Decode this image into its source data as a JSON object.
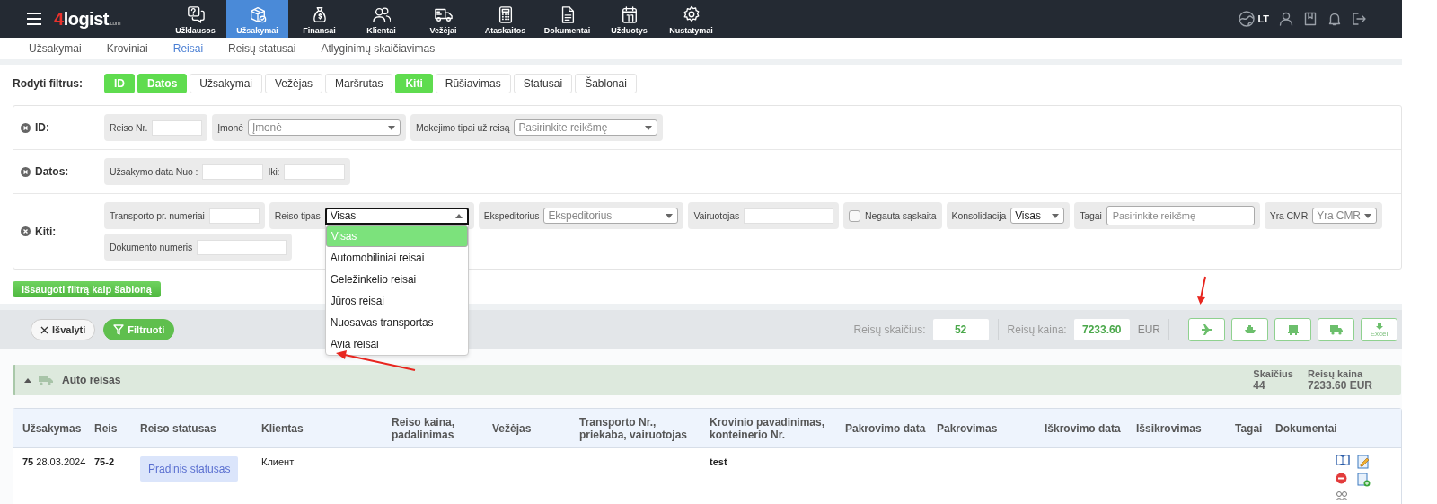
{
  "nav": {
    "logo": {
      "mark": "4",
      "name": "logist",
      "suffix": ".com"
    },
    "items": [
      {
        "label": "Užklausos",
        "selected": false
      },
      {
        "label": "Užsakymai",
        "selected": true
      },
      {
        "label": "Finansai",
        "selected": false
      },
      {
        "label": "Klientai",
        "selected": false
      },
      {
        "label": "Vežėjai",
        "selected": false
      },
      {
        "label": "Ataskaitos",
        "selected": false
      },
      {
        "label": "Dokumentai",
        "selected": false
      },
      {
        "label": "Užduotys",
        "selected": false
      },
      {
        "label": "Nustatymai",
        "selected": false
      }
    ],
    "language": "LT"
  },
  "subnav": [
    {
      "label": "Užsakymai",
      "selected": false
    },
    {
      "label": "Kroviniai",
      "selected": false
    },
    {
      "label": "Reisai",
      "selected": true
    },
    {
      "label": "Reisų statusai",
      "selected": false
    },
    {
      "label": "Atlyginimų skaičiavimas",
      "selected": false
    }
  ],
  "filters": {
    "label": "Rodyti filtrus:",
    "toggles": [
      {
        "label": "ID",
        "on": true
      },
      {
        "label": "Datos",
        "on": true
      },
      {
        "label": "Užsakymai",
        "on": false
      },
      {
        "label": "Vežėjas",
        "on": false
      },
      {
        "label": "Maršrutas",
        "on": false
      },
      {
        "label": "Kiti",
        "on": true
      },
      {
        "label": "Rūšiavimas",
        "on": false
      },
      {
        "label": "Statusai",
        "on": false
      },
      {
        "label": "Šablonai",
        "on": false
      }
    ]
  },
  "filter_rows": [
    {
      "label": "ID:",
      "groups": [
        {
          "kind": "text",
          "label": "Reiso Nr."
        },
        {
          "kind": "select",
          "label": "Įmonė",
          "placeholder": "Įmonė",
          "expanded": false
        },
        {
          "kind": "select",
          "label": "Mokėjimo tipai už reisą",
          "placeholder": "Pasirinkite reikšmę",
          "expanded": false
        }
      ]
    },
    {
      "label": "Datos:",
      "groups": [
        {
          "kind": "range",
          "label": "Užsakymo data Nuo :",
          "to_label": "Iki:"
        }
      ]
    },
    {
      "label": "Kiti:",
      "groups": [
        {
          "kind": "text",
          "label": "Transporto pr. numeriai"
        },
        {
          "kind": "select",
          "label": "Reiso tipas",
          "value": "Visas",
          "expanded": true,
          "options": [
            {
              "label": "Visas",
              "selected": true
            },
            {
              "label": "Automobiliniai reisai",
              "selected": false
            },
            {
              "label": "Geležinkelio reisai",
              "selected": false
            },
            {
              "label": "Jūros reisai",
              "selected": false
            },
            {
              "label": "Nuosavas transportas",
              "selected": false
            },
            {
              "label": "Avia reisai",
              "selected": false
            }
          ]
        },
        {
          "kind": "select",
          "label": "Ekspeditorius",
          "placeholder": "Ekspeditorius",
          "expanded": false
        },
        {
          "kind": "text",
          "label": "Vairuotojas"
        },
        {
          "kind": "checkbox",
          "label": "Negauta sąskaita",
          "checked": false
        },
        {
          "kind": "select",
          "label": "Konsolidacija",
          "value": "Visas",
          "expanded": false
        },
        {
          "kind": "tags",
          "label": "Tagai",
          "placeholder": "Pasirinkite reikšmę"
        },
        {
          "kind": "select",
          "label": "Yra CMR",
          "placeholder": "Yra CMR",
          "expanded": false
        },
        {
          "kind": "text",
          "label": "Dokumento numeris"
        }
      ]
    }
  ],
  "save_button": "Išsaugoti filtrą kaip šabloną",
  "toolbar": {
    "clear_button": "Išvalyti",
    "filter_button": "Filtruoti",
    "stats": [
      {
        "label": "Reisų skaičius:",
        "value": "52"
      },
      {
        "label": "Reisų kaina:",
        "value": "7233.60",
        "unit": "EUR"
      }
    ],
    "export_label": "Excel"
  },
  "group": {
    "title": "Auto reisas",
    "expanded": true,
    "stats": [
      {
        "label": "Skaičius",
        "value": "44"
      },
      {
        "label": "Reisų kaina",
        "value": "7233.60 EUR"
      }
    ]
  },
  "table": {
    "columns": [
      "Užsakymas",
      "Reis",
      "Reiso statusas",
      "Klientas",
      "Reiso kaina, padalinimas",
      "Vežėjas",
      "Transporto Nr., priekaba, vairuotojas",
      "Krovinio pavadinimas, konteinerio Nr.",
      "Pakrovimo data",
      "Pakrovimas",
      "Iškrovimo data",
      "Išsikrovimas",
      "Tagai",
      "Dokumentai"
    ],
    "rows": [
      {
        "order": "**75** 28.03.2024",
        "trip": "75-2",
        "status": "Pradinis statusas",
        "client": "Клиент",
        "cargo": "test"
      }
    ]
  }
}
